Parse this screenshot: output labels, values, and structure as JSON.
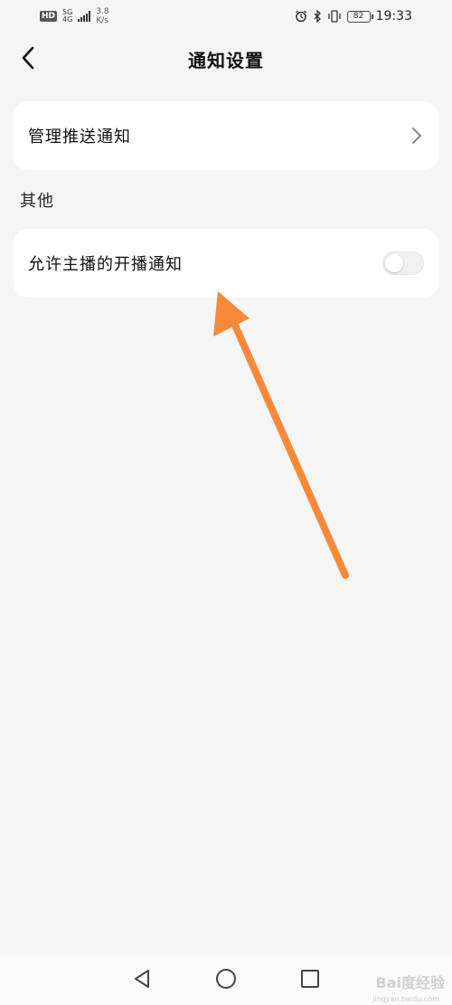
{
  "status_bar": {
    "hd": "HD",
    "net_type_top": "5G",
    "net_type_bottom": "4G",
    "speed_value": "3.8",
    "speed_unit": "K/s",
    "battery": "82",
    "time": "19:33"
  },
  "header": {
    "title": "通知设置"
  },
  "items": {
    "push_label": "管理推送通知",
    "section_title": "其他",
    "live_label": "允许主播的开播通知",
    "live_toggle_on": false
  },
  "colors": {
    "annotation_arrow": "#f5893a"
  },
  "watermark": {
    "brand": "Bai度经验",
    "url": "jingyan.baidu.com"
  }
}
